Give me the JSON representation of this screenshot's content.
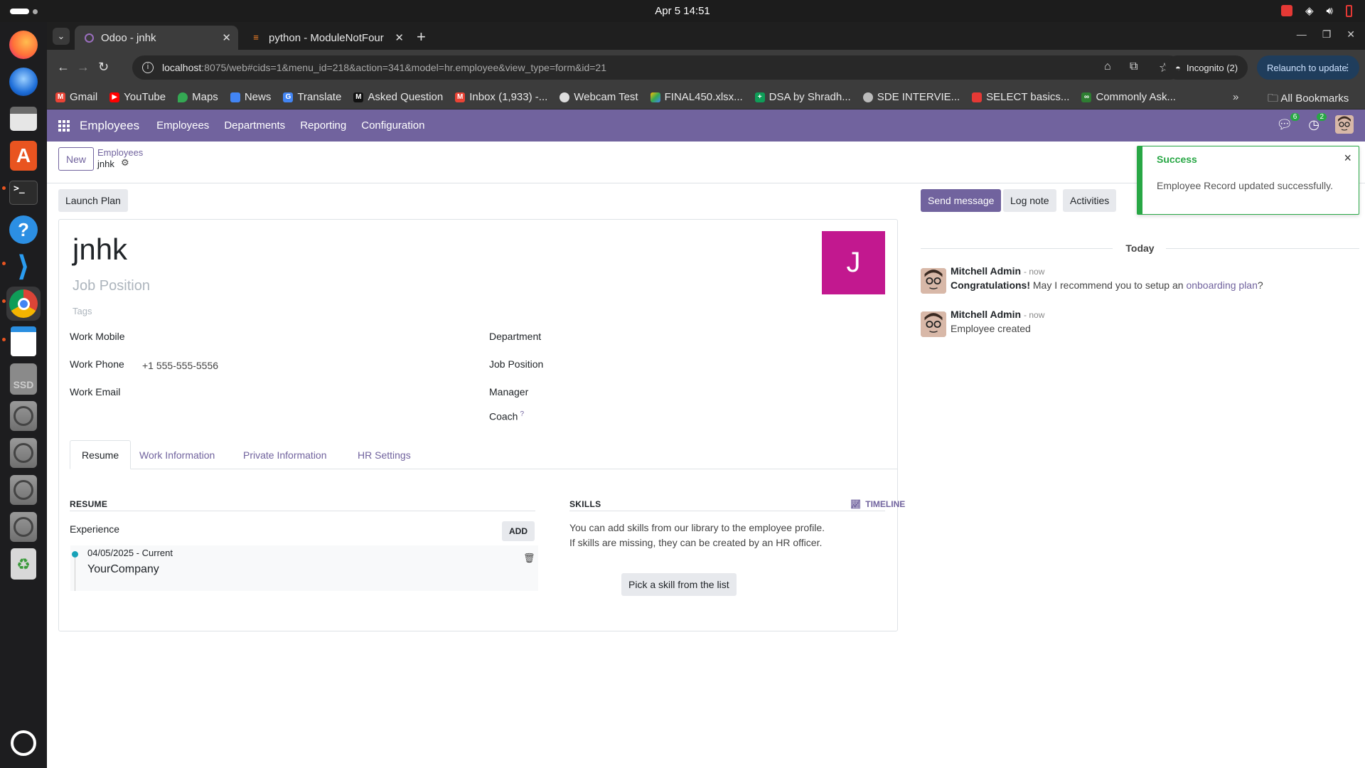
{
  "os": {
    "clock": "Apr 5  14:51"
  },
  "browser": {
    "tabs": [
      {
        "title": "Odoo - jnhk",
        "active": true
      },
      {
        "title": "python - ModuleNotFour",
        "active": false
      }
    ],
    "url_host": "localhost",
    "url_rest": ":8075/web#cids=1&menu_id=218&action=341&model=hr.employee&view_type=form&id=21",
    "incognito": "Incognito (2)",
    "relaunch": "Relaunch to update",
    "bookmarks": [
      {
        "label": "Gmail",
        "color": "#ea4335"
      },
      {
        "label": "YouTube",
        "color": "#ff0000"
      },
      {
        "label": "Maps",
        "color": "#34a853"
      },
      {
        "label": "News",
        "color": "#4285f4"
      },
      {
        "label": "Translate",
        "color": "#4285f4"
      },
      {
        "label": "Asked Question",
        "color": "#222222"
      },
      {
        "label": "Inbox (1,933) -...",
        "color": "#ea4335"
      },
      {
        "label": "Webcam Test",
        "color": "#dddddd"
      },
      {
        "label": "FINAL450.xlsx...",
        "color": "#34a853"
      },
      {
        "label": "DSA by Shradh...",
        "color": "#0f9d58"
      },
      {
        "label": "SDE INTERVIE...",
        "color": "#bbbbbb"
      },
      {
        "label": "SELECT basics...",
        "color": "#e53935"
      },
      {
        "label": "Commonly Ask...",
        "color": "#2e7d32"
      }
    ],
    "all_bookmarks": "All Bookmarks"
  },
  "odoo": {
    "brand": "Employees",
    "menu": [
      "Employees",
      "Departments",
      "Reporting",
      "Configuration"
    ],
    "chat_count": "6",
    "activity_count": "2",
    "new_button": "New",
    "breadcrumb_parent": "Employees",
    "breadcrumb_current": "jnhk",
    "launch_plan": "Launch Plan",
    "send_message": "Send message",
    "log_note": "Log note",
    "activities": "Activities",
    "toast": {
      "title": "Success",
      "body": "Employee Record updated successfully."
    },
    "employee": {
      "name": "jnhk",
      "job_placeholder": "Job Position",
      "tags_placeholder": "Tags",
      "avatar_letter": "J",
      "avatar_color": "#c2188f",
      "work_mobile_label": "Work Mobile",
      "work_phone_label": "Work Phone",
      "work_phone": "+1 555-555-5556",
      "work_email_label": "Work Email",
      "department_label": "Department",
      "job_position_label": "Job Position",
      "manager_label": "Manager",
      "coach_label": "Coach",
      "coach_help": "?"
    },
    "tabs": [
      "Resume",
      "Work Information",
      "Private Information",
      "HR Settings"
    ],
    "resume": {
      "title": "RESUME",
      "experience": "Experience",
      "add": "ADD",
      "date": "04/05/2025 - Current",
      "company": "YourCompany"
    },
    "skills": {
      "title": "SKILLS",
      "timeline": "TIMELINE",
      "text1": "You can add skills from our library to the employee profile.",
      "text2": "If skills are missing, they can be created by an HR officer.",
      "pick": "Pick a skill from the list"
    },
    "chatter": {
      "today": "Today",
      "messages": [
        {
          "author": "Mitchell Admin",
          "time": "- now",
          "bold": "Congratulations!",
          "text": " May I recommend you to setup an ",
          "link": "onboarding plan",
          "tail": "?"
        },
        {
          "author": "Mitchell Admin",
          "time": "- now",
          "text": "Employee created"
        }
      ]
    },
    "accent": "#71639e"
  }
}
